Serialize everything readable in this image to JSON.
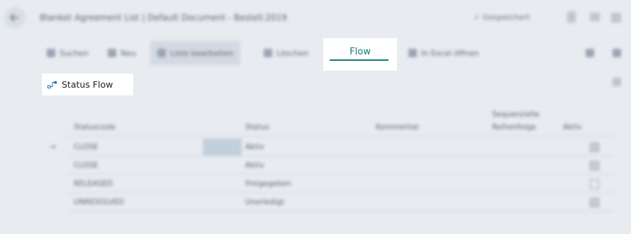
{
  "page": {
    "title": "Blanket Agreement List | Default Document - Bestell.2019",
    "saved": "✓ Gespeichert"
  },
  "actions": [
    {
      "name": "action-search",
      "label": "Suchen",
      "icon": "search-icon"
    },
    {
      "name": "action-new",
      "label": "Neu",
      "icon": "plus-icon"
    },
    {
      "name": "action-edit-list",
      "label": "Liste bearbeiten",
      "icon": "grid-icon"
    },
    {
      "name": "action-delete",
      "label": "Löschen",
      "icon": "trash-icon"
    },
    {
      "name": "action-open-excel",
      "label": "In Excel öffnen",
      "icon": "excel-icon"
    }
  ],
  "tabs": {
    "flow": "Flow"
  },
  "subtabs": {
    "status_flow": "Status Flow"
  },
  "table": {
    "headers": {
      "c1": "Statuscode",
      "c2": "Status",
      "c3": "Kommentar",
      "c4a": "Sequenzielle",
      "c4b": "Reihenfolge",
      "c5": "Aktiv"
    },
    "rows": [
      {
        "code": "CLOSE",
        "status": "Aktiv",
        "comment": "",
        "seq": "",
        "active": true
      },
      {
        "code": "CLOSE",
        "status": "Aktiv",
        "comment": "",
        "seq": "",
        "active": true
      },
      {
        "code": "RELEASED",
        "status": "Freigegeben",
        "comment": "",
        "seq": "",
        "active": false
      },
      {
        "code": "UNRESOLVED",
        "status": "Unerledigt",
        "comment": "",
        "seq": "",
        "active": true
      }
    ]
  },
  "colors": {
    "accent": "#137a74",
    "background": "#e8ebf0"
  }
}
